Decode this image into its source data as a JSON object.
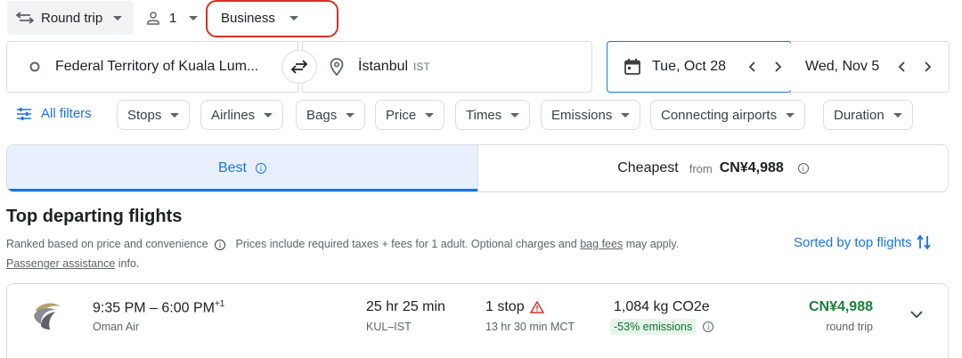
{
  "search_bar": {
    "trip_type": "Round trip",
    "passengers": "1",
    "cabin_class": "Business"
  },
  "route": {
    "origin": "Federal Territory of Kuala Lum...",
    "destination": "İstanbul",
    "destination_code": "IST"
  },
  "dates": {
    "departure": "Tue, Oct 28",
    "return": "Wed, Nov 5"
  },
  "filters": {
    "all_filters": "All filters",
    "chips": [
      "Stops",
      "Airlines",
      "Bags",
      "Price",
      "Times",
      "Emissions",
      "Connecting airports",
      "Duration"
    ]
  },
  "tabs": {
    "best": "Best",
    "cheapest": "Cheapest",
    "cheapest_from": "from",
    "cheapest_price": "CN¥4,988"
  },
  "results": {
    "heading": "Top departing flights",
    "ranked_note": "Ranked based on price and convenience",
    "price_note_1": "Prices include required taxes + fees for 1 adult. Optional charges and",
    "bag_fees": "bag fees",
    "price_note_2": "may apply.",
    "passenger_assistance": "Passenger assistance",
    "info_suffix": "info.",
    "sorted": "Sorted by top flights"
  },
  "flights": [
    {
      "times": "9:35 PM – 6:00 PM",
      "day_offset": "+1",
      "airline": "Oman Air",
      "duration": "25 hr 25 min",
      "route_codes": "KUL–IST",
      "stops": "1 stop",
      "layover": "13 hr 30 min MCT",
      "emissions": "1,084 kg CO2e",
      "emissions_delta": "-53% emissions",
      "price": "CN¥4,988",
      "price_note": "round trip"
    }
  ],
  "colors": {
    "accent": "#1a73e8",
    "price_green": "#188038",
    "highlight_red": "#d93025",
    "warning_red": "#d93025"
  }
}
